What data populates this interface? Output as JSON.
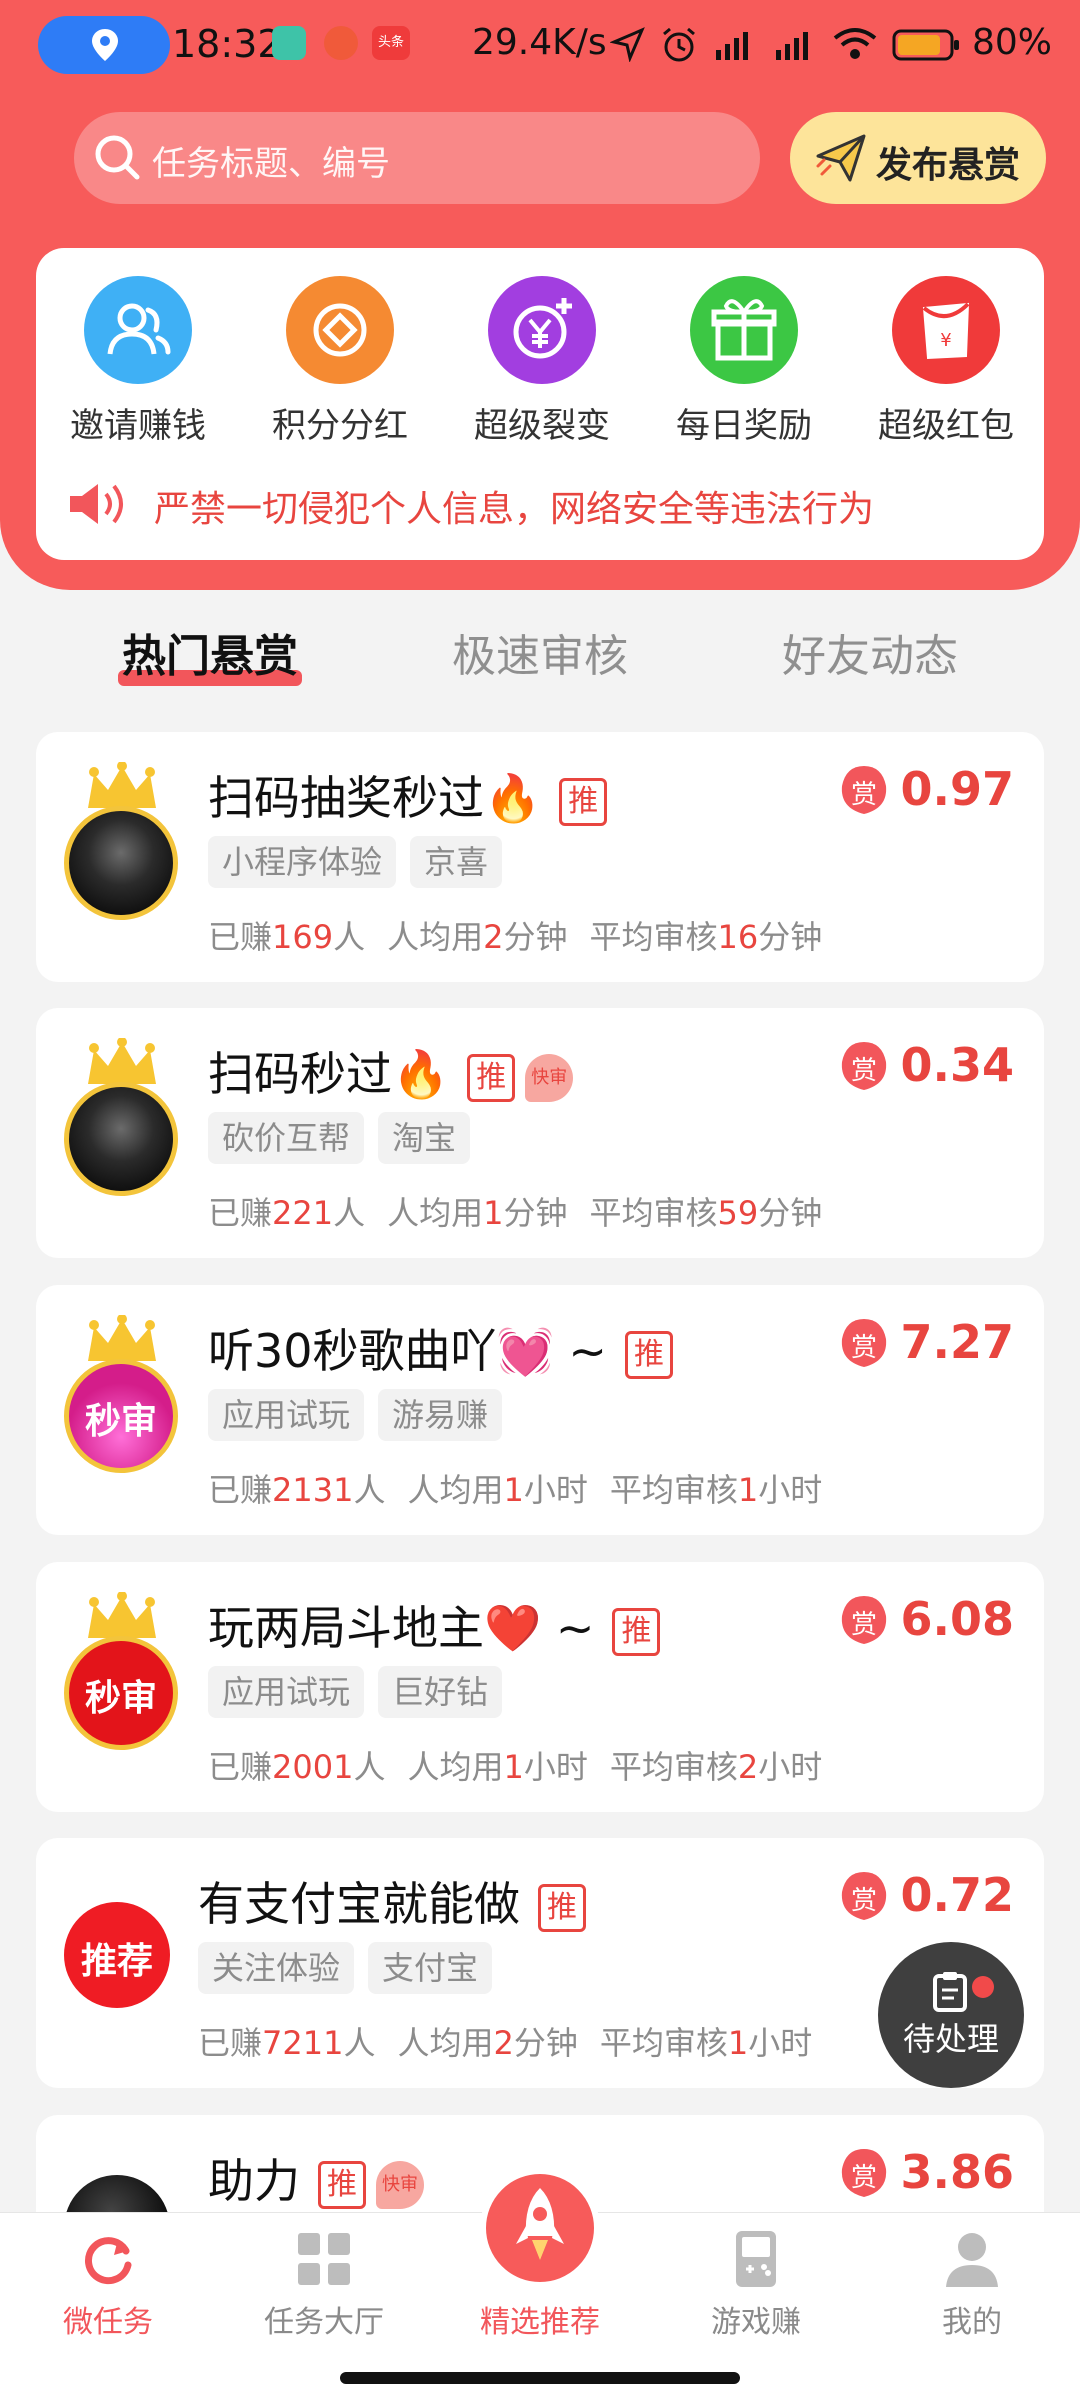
{
  "status_bar": {
    "time": "18:32",
    "net_speed": "29.4K/s",
    "battery": "80%",
    "notif_toutiao": "头条"
  },
  "search": {
    "placeholder": "任务标题、编号"
  },
  "publish": {
    "label": "发布悬赏"
  },
  "menu": [
    {
      "label": "邀请赚钱",
      "icon": "invite-users-icon",
      "color": "#3fb0f5"
    },
    {
      "label": "积分分红",
      "icon": "points-coin-icon",
      "color": "#f58a32"
    },
    {
      "label": "超级裂变",
      "icon": "yuan-plus-icon",
      "color": "#a23ee0"
    },
    {
      "label": "每日奖励",
      "icon": "gift-box-icon",
      "color": "#3cc744"
    },
    {
      "label": "超级红包",
      "icon": "red-packet-icon",
      "color": "#f03a3a"
    }
  ],
  "notice": {
    "text": "严禁一切侵犯个人信息，网络安全等违法行为"
  },
  "tabs": [
    {
      "label": "热门悬赏",
      "active": true
    },
    {
      "label": "极速审核",
      "active": false
    },
    {
      "label": "好友动态",
      "active": false
    }
  ],
  "labels": {
    "earned_prefix": "已赚",
    "earned_suffix": "人",
    "avg_prefix": "人均用",
    "review_prefix": "平均审核",
    "tui": "推",
    "fast": "快审",
    "reward_icon": "赏",
    "miaoshen": "秒审",
    "tuijian": "推荐"
  },
  "tasks": [
    {
      "title": "扫码抽奖秒过🔥",
      "fast": false,
      "tags": [
        "小程序体验",
        "京喜"
      ],
      "earned": "169",
      "avg_value": "2",
      "avg_unit": "分钟",
      "review_value": "16",
      "review_unit": "分钟",
      "reward": "0.97",
      "avatar": "crown-photo"
    },
    {
      "title": "扫码秒过🔥",
      "fast": true,
      "tags": [
        "砍价互帮",
        "淘宝"
      ],
      "earned": "221",
      "avg_value": "1",
      "avg_unit": "分钟",
      "review_value": "59",
      "review_unit": "分钟",
      "reward": "0.34",
      "avatar": "crown-photo"
    },
    {
      "title": "听30秒歌曲吖💓 ~",
      "fast": false,
      "tags": [
        "应用试玩",
        "游易赚"
      ],
      "earned": "2131",
      "avg_value": "1",
      "avg_unit": "小时",
      "review_value": "1",
      "review_unit": "小时",
      "reward": "7.27",
      "avatar": "crown-miaoshen-pink"
    },
    {
      "title": "玩两局斗地主❤️ ~",
      "fast": false,
      "tags": [
        "应用试玩",
        "巨好钻"
      ],
      "earned": "2001",
      "avg_value": "1",
      "avg_unit": "小时",
      "review_value": "2",
      "review_unit": "小时",
      "reward": "6.08",
      "avatar": "crown-miaoshen-red"
    },
    {
      "title": "有支付宝就能做",
      "fast": false,
      "tags": [
        "关注体验",
        "支付宝"
      ],
      "earned": "7211",
      "avg_value": "2",
      "avg_unit": "分钟",
      "review_value": "1",
      "review_unit": "小时",
      "reward": "0.72",
      "avatar": "tuijian"
    },
    {
      "title": "助力",
      "fast": true,
      "tags": [],
      "earned": "",
      "avg_value": "",
      "avg_unit": "",
      "review_value": "",
      "review_unit": "",
      "reward": "3.86",
      "avatar": "dark-photo"
    }
  ],
  "pending": {
    "label": "待处理"
  },
  "bottom_nav": [
    {
      "label": "微任务",
      "icon": "refresh-icon",
      "active": true
    },
    {
      "label": "任务大厅",
      "icon": "grid-icon",
      "active": false
    },
    {
      "label": "精选推荐",
      "icon": "rocket-icon",
      "active": false
    },
    {
      "label": "游戏赚",
      "icon": "gameboy-icon",
      "active": false
    },
    {
      "label": "我的",
      "icon": "user-icon",
      "active": false
    }
  ],
  "colors": {
    "brand": "#f75b5a",
    "accent_red": "#e8453f",
    "publish_bg": "#fde49a"
  }
}
